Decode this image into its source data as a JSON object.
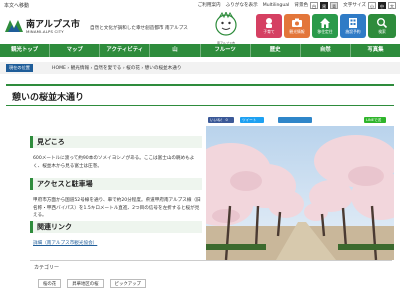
{
  "util": {
    "skip": "本文へ移動",
    "print": "ご利用案内",
    "yasashii": "ふりがなを表示",
    "multilingual": "Multilingual",
    "bg_label": "背景色",
    "bg_white": "白",
    "bg_black": "黒",
    "bg_gray": "青",
    "font_label": "文字サイズ",
    "font_small": "小",
    "font_mid": "中",
    "font_large": "大"
  },
  "header": {
    "logo_title": "南アルプス市",
    "logo_sub": "MINAMI-ALPS CITY",
    "tagline": "自然と文化が調和した幸せ創造都市 南アルプス",
    "mascot_sub": "南アルプス市 2021.10.01",
    "quick": [
      {
        "label": "子育て",
        "icon": "baby-icon"
      },
      {
        "label": "観光情報",
        "icon": "camera-icon"
      },
      {
        "label": "移住定住",
        "icon": "house-icon"
      },
      {
        "label": "施設予約",
        "icon": "building-icon"
      },
      {
        "label": "検索",
        "icon": "search-icon"
      }
    ]
  },
  "nav": [
    "観光トップ",
    "マップ",
    "アクティビティ",
    "山",
    "フルーツ",
    "歴史",
    "自然",
    "写真集"
  ],
  "breadcrumb": {
    "here": "現在の位置",
    "path": "HOME › 観光情報 › 自然を愛でる › 桜の花 › 憩いの桜並木通り"
  },
  "page": {
    "title": "憩いの桜並木通り",
    "share": {
      "facebook": "いいね！ 0",
      "twitter": "ツイート",
      "line": "LINEで送る"
    }
  },
  "sections": {
    "highlight_head": "見どころ",
    "highlight_body": "600メートルに渡って約90本のソメイヨシノがある。ここは富士山の眺めもよく、桜並木から見る富士は圧巻。",
    "access_head": "アクセスと駐車場",
    "access_body": "甲府市方面から国道52号線を通り、車で約20分程度。県道甲府南アルプス線（旧名称・甲西バイパス）を1.5キロメートル直進、2つ目の信号を左折すると桜が見える。",
    "links_head": "関連リンク",
    "links_body": "詳細（南アルプス市観光協会）"
  },
  "category": {
    "title": "カテゴリー",
    "tags": [
      "桜の花",
      "昇華地区の桜",
      "ピックアップ"
    ]
  },
  "colors": {
    "accent": "#2e8c3c",
    "crumb": "#1f5d99"
  }
}
